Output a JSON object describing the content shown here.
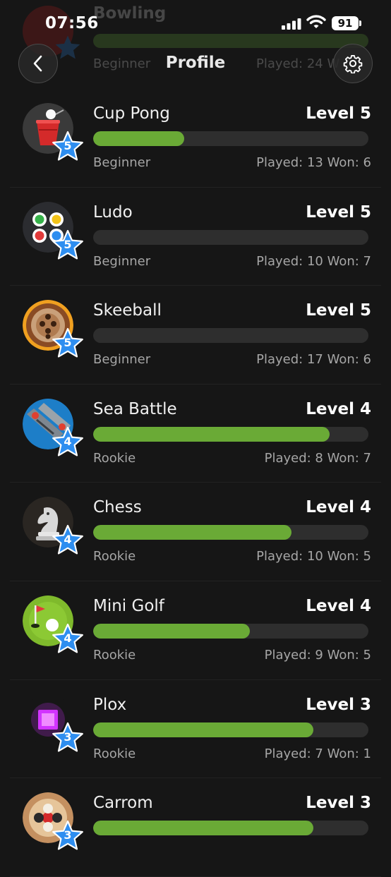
{
  "status_bar": {
    "time": "07:56",
    "battery": "91"
  },
  "header": {
    "title": "Profile"
  },
  "ghost_row": {
    "name": "Bowling",
    "tier": "Beginner",
    "stats": "Played: 24 W"
  },
  "colors": {
    "bar_fill": "#6aaa36",
    "bar_track": "#2e2e2e",
    "star": "#2e8ef0",
    "background": "#161616"
  },
  "games": [
    {
      "name": "Cup Pong",
      "level": "Level 5",
      "star": "5",
      "progress": 0.33,
      "tier": "Beginner",
      "stats": "Played: 13 Won: 6",
      "icon": "cup-pong-icon"
    },
    {
      "name": "Ludo",
      "level": "Level 5",
      "star": "5",
      "progress": 0.0,
      "tier": "Beginner",
      "stats": "Played: 10 Won: 7",
      "icon": "ludo-icon"
    },
    {
      "name": "Skeeball",
      "level": "Level 5",
      "star": "5",
      "progress": 0.0,
      "tier": "Beginner",
      "stats": "Played: 17 Won: 6",
      "icon": "skeeball-icon"
    },
    {
      "name": "Sea Battle",
      "level": "Level 4",
      "star": "4",
      "progress": 0.86,
      "tier": "Rookie",
      "stats": "Played: 8 Won: 7",
      "icon": "sea-battle-icon"
    },
    {
      "name": "Chess",
      "level": "Level 4",
      "star": "4",
      "progress": 0.72,
      "tier": "Rookie",
      "stats": "Played: 10 Won: 5",
      "icon": "chess-icon"
    },
    {
      "name": "Mini Golf",
      "level": "Level 4",
      "star": "4",
      "progress": 0.57,
      "tier": "Rookie",
      "stats": "Played: 9 Won: 5",
      "icon": "mini-golf-icon"
    },
    {
      "name": "Plox",
      "level": "Level 3",
      "star": "3",
      "progress": 0.8,
      "tier": "Rookie",
      "stats": "Played: 7 Won: 1",
      "icon": "plox-icon"
    },
    {
      "name": "Carrom",
      "level": "Level 3",
      "star": "3",
      "progress": 0.8,
      "tier": "",
      "stats": "",
      "icon": "carrom-icon"
    }
  ]
}
